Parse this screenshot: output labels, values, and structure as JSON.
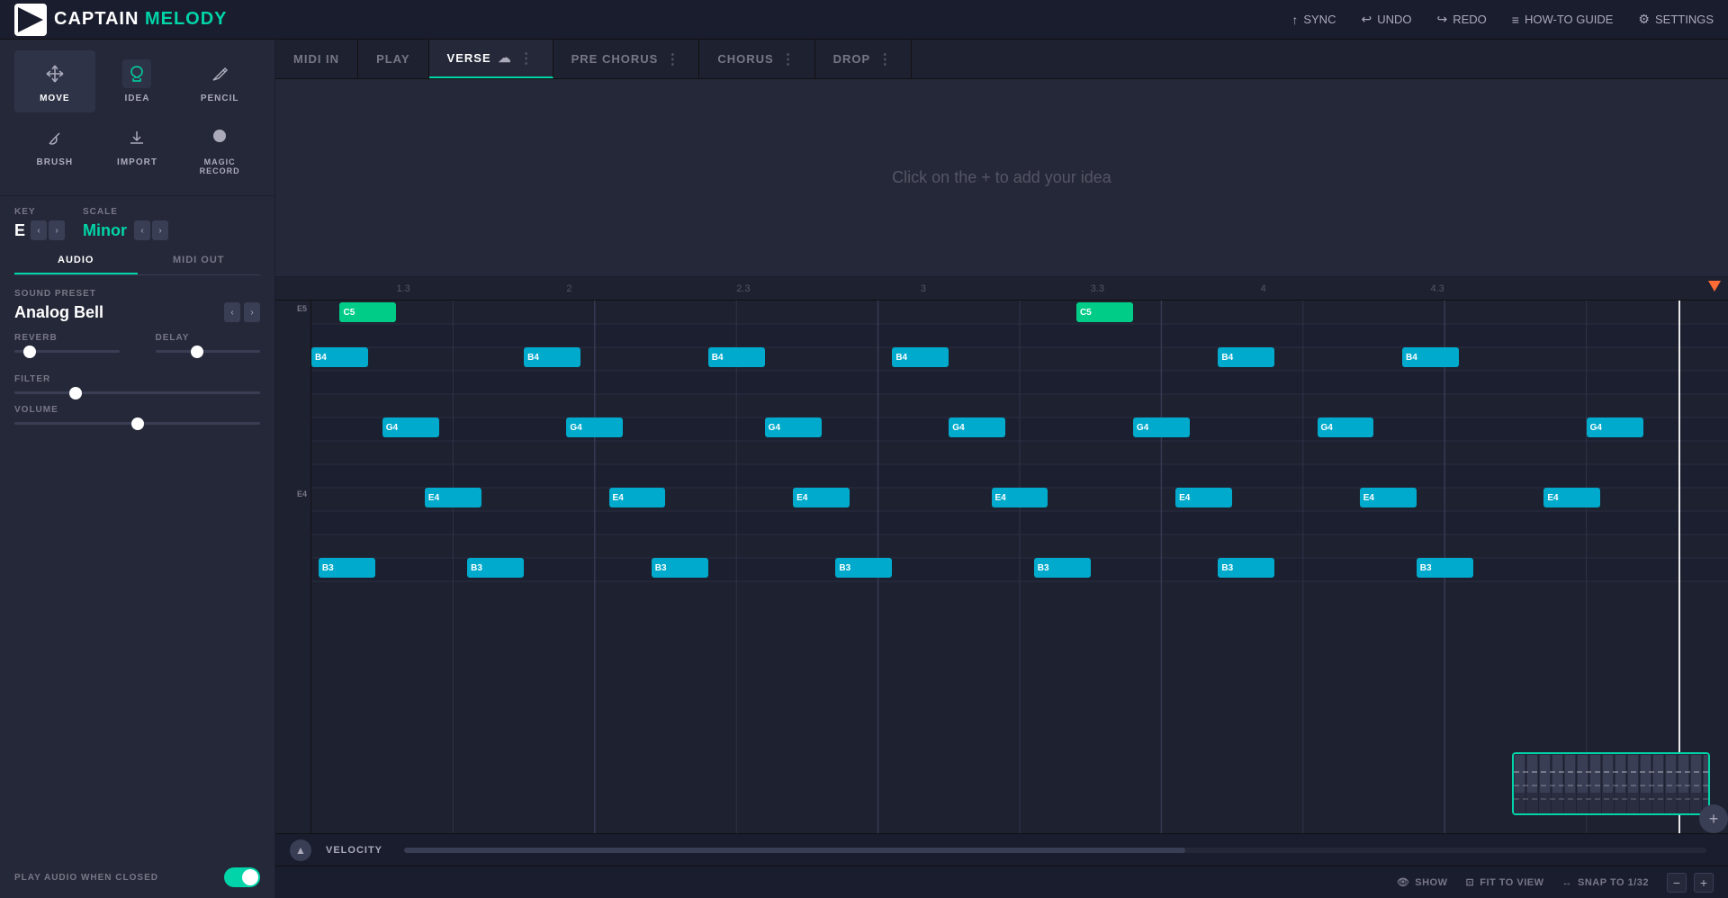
{
  "app": {
    "logo_captain": "CAPTAIN",
    "logo_melody": "MELODY"
  },
  "top_actions": [
    {
      "id": "sync",
      "label": "SYNC",
      "icon": "↑"
    },
    {
      "id": "undo",
      "label": "UNDO",
      "icon": "↩"
    },
    {
      "id": "redo",
      "label": "REDO",
      "icon": "↪"
    },
    {
      "id": "how_to",
      "label": "HOW-TO GUIDE",
      "icon": "≡"
    },
    {
      "id": "settings",
      "label": "SETTINGS",
      "icon": "⚙"
    }
  ],
  "tools": [
    {
      "id": "move",
      "label": "MOVE",
      "icon": "↖",
      "active": true
    },
    {
      "id": "idea",
      "label": "IDEA",
      "icon": "✏",
      "active": false
    },
    {
      "id": "pencil",
      "label": "PENCIL",
      "icon": "✎",
      "active": false
    },
    {
      "id": "brush",
      "label": "BRUSH",
      "icon": "🖌",
      "active": false
    },
    {
      "id": "import",
      "label": "IMPORT",
      "icon": "⬆",
      "active": false
    },
    {
      "id": "magic_record",
      "label": "MAGIC RECORD",
      "icon": "●",
      "active": false
    }
  ],
  "key": {
    "label": "KEY",
    "value": "E"
  },
  "scale": {
    "label": "SCALE",
    "value": "Minor"
  },
  "tabs": [
    {
      "id": "audio",
      "label": "AUDIO",
      "active": true
    },
    {
      "id": "midi_out",
      "label": "MIDI OUT",
      "active": false
    }
  ],
  "sound_preset": {
    "label": "SOUND PRESET",
    "value": "Analog Bell"
  },
  "effects": {
    "reverb": {
      "label": "REVERB",
      "value": 15
    },
    "delay": {
      "label": "DELAY",
      "value": 40
    }
  },
  "filter": {
    "label": "FILTER",
    "value": 25
  },
  "volume": {
    "label": "VOLUME",
    "value": 50
  },
  "play_audio_when_closed": {
    "label": "PLAY AUDIO WHEN CLOSED",
    "enabled": true
  },
  "section_tabs": [
    {
      "id": "midi_in",
      "label": "MIDI IN",
      "active": false
    },
    {
      "id": "play",
      "label": "PLAY",
      "active": false
    },
    {
      "id": "verse",
      "label": "VERSE",
      "active": true
    },
    {
      "id": "pre_chorus",
      "label": "PRE CHORUS",
      "active": false
    },
    {
      "id": "chorus",
      "label": "CHORUS",
      "active": false
    },
    {
      "id": "drop",
      "label": "DROP",
      "active": false
    }
  ],
  "empty_section_text": "Click on the + to add your idea",
  "timeline": {
    "marks": [
      "1.3",
      "2",
      "2.3",
      "3",
      "3.3",
      "4",
      "4.3"
    ]
  },
  "notes": [
    {
      "id": "b4_1",
      "pitch": "B4",
      "col": 1,
      "type": "cyan"
    },
    {
      "id": "c5_1",
      "pitch": "C5",
      "col": 2,
      "type": "green"
    },
    {
      "id": "g4_1",
      "pitch": "G4",
      "col": 3,
      "type": "cyan"
    },
    {
      "id": "e4_1",
      "pitch": "E4",
      "col": 4,
      "type": "cyan"
    },
    {
      "id": "b3_1",
      "pitch": "B3",
      "col": 5,
      "type": "cyan"
    },
    {
      "id": "b4_2",
      "pitch": "B4",
      "col": 6,
      "type": "cyan"
    },
    {
      "id": "g4_2",
      "pitch": "G4",
      "col": 7,
      "type": "cyan"
    },
    {
      "id": "e4_2",
      "pitch": "E4",
      "col": 8,
      "type": "cyan"
    },
    {
      "id": "b3_2",
      "pitch": "B3",
      "col": 9,
      "type": "cyan"
    }
  ],
  "piano_keys": [
    "E5",
    "E4"
  ],
  "velocity_label": "VELOCITY",
  "footer": {
    "show_label": "SHOW",
    "fit_to_view_label": "FIT TO VIEW",
    "snap_label": "SNAP TO 1/32"
  }
}
